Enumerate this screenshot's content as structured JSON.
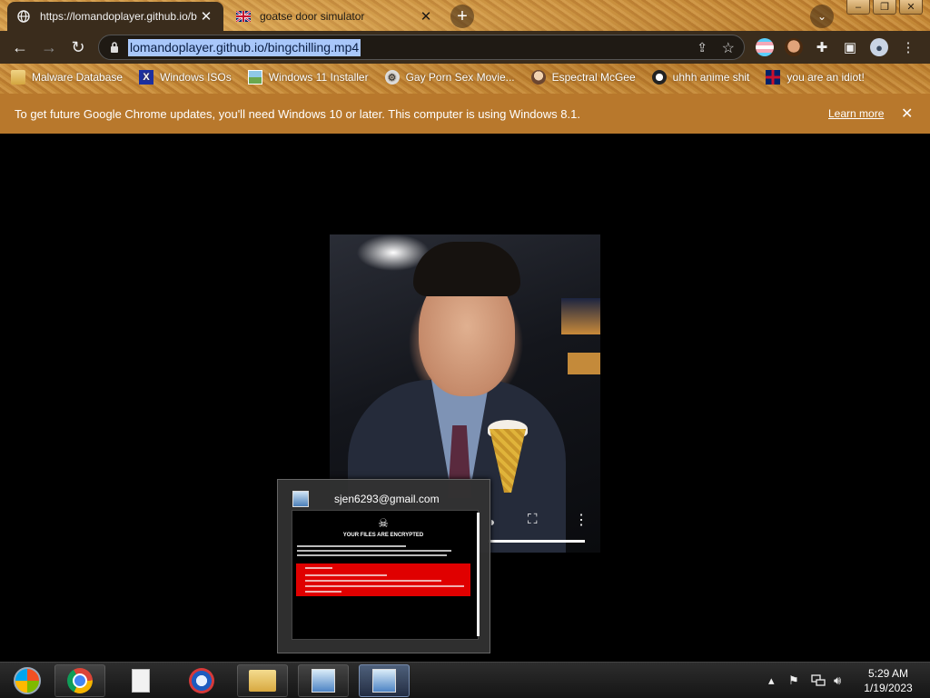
{
  "tabs": [
    {
      "title": "https://lomandoplayer.github.io/b",
      "favicon": "globe-icon",
      "active": true
    },
    {
      "title": "goatse door simulator",
      "favicon": "uk-flag-icon",
      "active": false
    }
  ],
  "omnibox": {
    "url": "lomandoplayer.github.io/bingchilling.mp4"
  },
  "bookmarks": [
    {
      "label": "Malware Database",
      "icon": "folder-icon"
    },
    {
      "label": "Windows ISOs",
      "icon": "x-logo-icon"
    },
    {
      "label": "Windows 11 Installer",
      "icon": "image-icon"
    },
    {
      "label": "Gay Porn Sex Movie...",
      "icon": "tool-icon"
    },
    {
      "label": "Espectral McGee",
      "icon": "face-icon"
    },
    {
      "label": "uhhh anime shit",
      "icon": "anime-icon"
    },
    {
      "label": "you are an idiot!",
      "icon": "uk-flag-icon"
    }
  ],
  "infobar": {
    "message": "To get future Google Chrome updates, you'll need Windows 10 or later. This computer is using Windows 8.1.",
    "learn_more": "Learn more"
  },
  "thumbnail": {
    "title": "sjen6293@gmail.com",
    "heading": "YOUR FILES ARE ENCRYPTED"
  },
  "clock": {
    "time": "5:29 AM",
    "date": "1/19/2023"
  },
  "colors": {
    "frame": "#c28633",
    "infobar": "#b8782c",
    "toolbar": "#3a2c1c",
    "url_highlight": "#a8c7fa",
    "ransom_red": "#e00000"
  }
}
